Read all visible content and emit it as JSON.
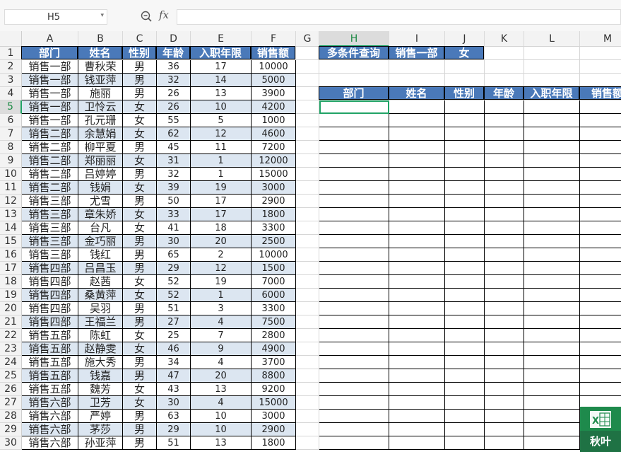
{
  "formula_bar": {
    "cell_ref": "H5",
    "fx": "fx",
    "formula": ""
  },
  "columns": [
    "A",
    "B",
    "C",
    "D",
    "E",
    "F",
    "G",
    "H",
    "I",
    "J",
    "K",
    "L",
    "M"
  ],
  "active_cell": {
    "col": "H",
    "row": 5
  },
  "rows": [
    1,
    2,
    3,
    4,
    5,
    6,
    7,
    8,
    9,
    10,
    11,
    12,
    13,
    14,
    15,
    16,
    17,
    18,
    19,
    20,
    21,
    22,
    23,
    24,
    25,
    26,
    27,
    28,
    29,
    30
  ],
  "table": {
    "headers": [
      "部门",
      "姓名",
      "性别",
      "年龄",
      "入职年限",
      "销售额"
    ],
    "rows": [
      [
        "销售一部",
        "曹秋荣",
        "男",
        "36",
        "17",
        "10000"
      ],
      [
        "销售一部",
        "钱亚萍",
        "男",
        "32",
        "14",
        "5000"
      ],
      [
        "销售一部",
        "施丽",
        "男",
        "26",
        "13",
        "3900"
      ],
      [
        "销售一部",
        "卫怜云",
        "女",
        "26",
        "10",
        "4200"
      ],
      [
        "销售一部",
        "孔元珊",
        "女",
        "55",
        "5",
        "1000"
      ],
      [
        "销售二部",
        "余慧娟",
        "女",
        "62",
        "12",
        "4600"
      ],
      [
        "销售二部",
        "柳平夏",
        "男",
        "45",
        "11",
        "7200"
      ],
      [
        "销售二部",
        "郑丽丽",
        "女",
        "31",
        "1",
        "12000"
      ],
      [
        "销售二部",
        "吕婷婷",
        "男",
        "32",
        "1",
        "15000"
      ],
      [
        "销售二部",
        "钱娟",
        "女",
        "39",
        "19",
        "3000"
      ],
      [
        "销售三部",
        "尤雪",
        "男",
        "50",
        "17",
        "2900"
      ],
      [
        "销售三部",
        "章朱娇",
        "女",
        "33",
        "17",
        "1800"
      ],
      [
        "销售三部",
        "台凡",
        "女",
        "41",
        "18",
        "3300"
      ],
      [
        "销售三部",
        "金巧丽",
        "男",
        "30",
        "20",
        "2500"
      ],
      [
        "销售三部",
        "钱红",
        "男",
        "65",
        "2",
        "10000"
      ],
      [
        "销售四部",
        "吕昌玉",
        "男",
        "29",
        "12",
        "1500"
      ],
      [
        "销售四部",
        "赵茜",
        "女",
        "52",
        "19",
        "7000"
      ],
      [
        "销售四部",
        "桑黄萍",
        "女",
        "52",
        "1",
        "6000"
      ],
      [
        "销售四部",
        "吴羽",
        "男",
        "51",
        "3",
        "3300"
      ],
      [
        "销售四部",
        "王福兰",
        "男",
        "27",
        "4",
        "7500"
      ],
      [
        "销售五部",
        "陈虹",
        "女",
        "25",
        "7",
        "2800"
      ],
      [
        "销售五部",
        "赵静雯",
        "女",
        "46",
        "9",
        "4900"
      ],
      [
        "销售五部",
        "施大秀",
        "男",
        "34",
        "4",
        "3700"
      ],
      [
        "销售五部",
        "钱嘉",
        "男",
        "47",
        "20",
        "8800"
      ],
      [
        "销售五部",
        "魏芳",
        "女",
        "43",
        "13",
        "9200"
      ],
      [
        "销售六部",
        "卫芳",
        "女",
        "30",
        "4",
        "15000"
      ],
      [
        "销售六部",
        "严婷",
        "男",
        "63",
        "10",
        "3000"
      ],
      [
        "销售六部",
        "茅莎",
        "男",
        "29",
        "10",
        "2900"
      ],
      [
        "销售六部",
        "孙亚萍",
        "男",
        "51",
        "13",
        "1800"
      ]
    ]
  },
  "query": {
    "label": "多条件查询",
    "department": "销售一部",
    "gender": "女"
  },
  "result_headers": [
    "部门",
    "姓名",
    "性别",
    "年龄",
    "入职年限",
    "销售额"
  ],
  "watermark": {
    "logo": "X",
    "text": "秋叶"
  },
  "colors": {
    "header_blue": "#4a79b9",
    "band": "#dce6f1",
    "accent_green": "#21a366"
  }
}
